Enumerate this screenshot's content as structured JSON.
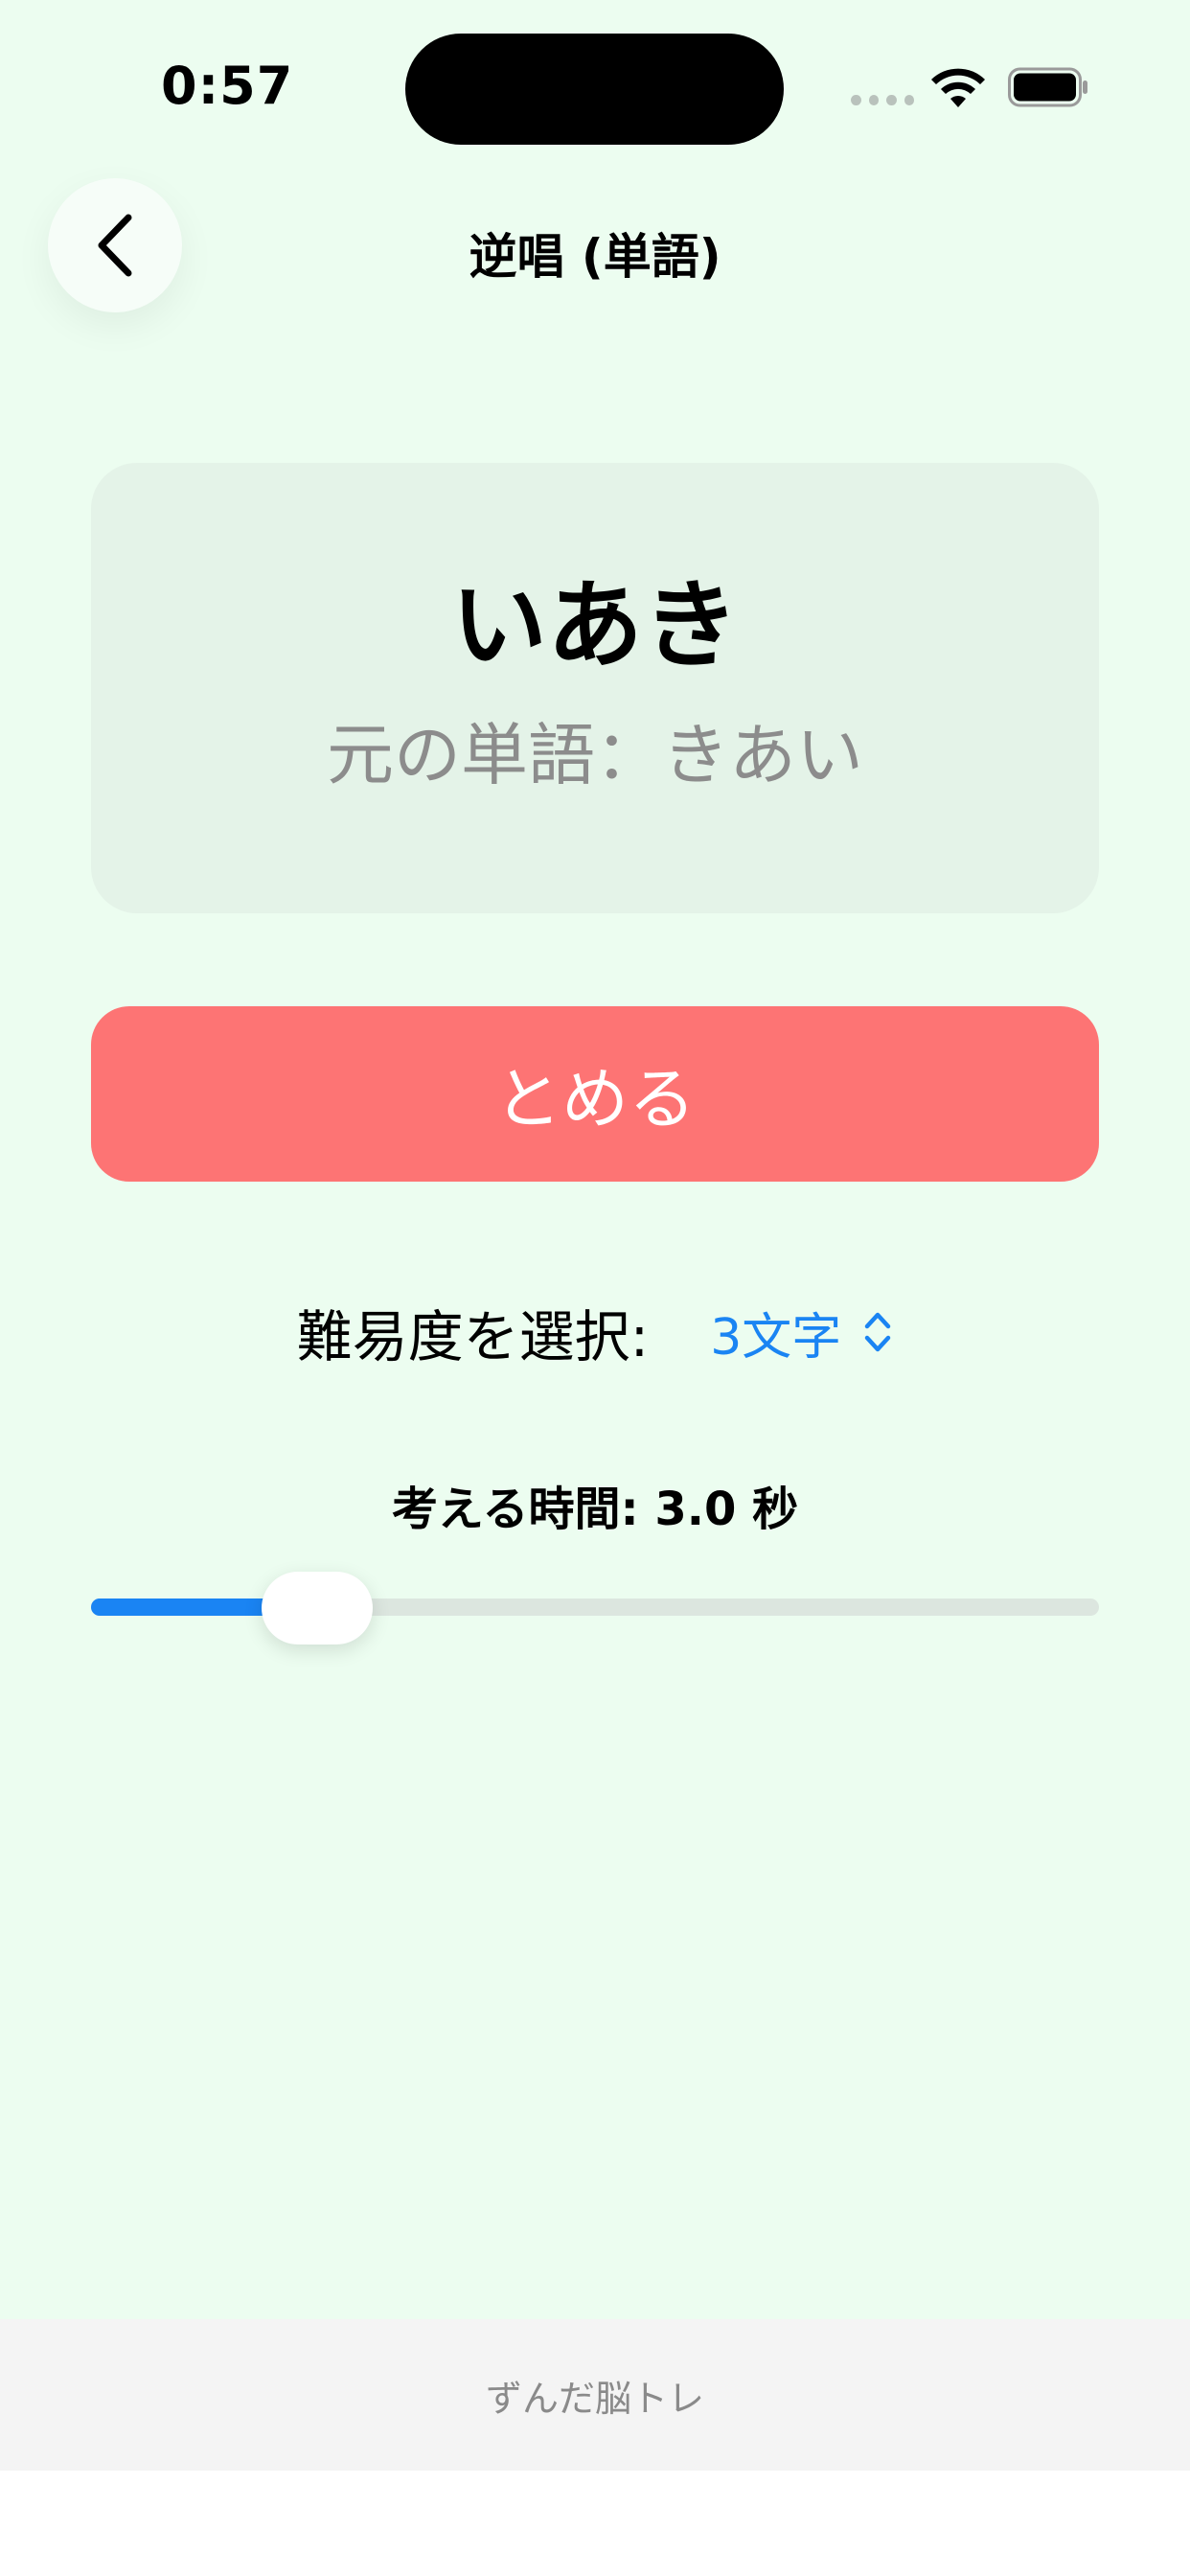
{
  "status_bar": {
    "time": "0:57",
    "wifi_icon": "wifi-icon",
    "battery_icon": "battery-icon",
    "signal_icon": "cellular-signal-icon"
  },
  "header": {
    "back_icon": "chevron-left-icon",
    "title": "逆唱 (単語)"
  },
  "card": {
    "reversed_word": "いあき",
    "original_word": "元の単語：きあい"
  },
  "stop_button": {
    "label": "とめる"
  },
  "difficulty": {
    "label": "難易度を選択:",
    "selected": "3文字",
    "icon": "chevron-up-down-icon"
  },
  "think_time": {
    "label": "考える時間: 3.0 秒",
    "slider_fraction": 0.19
  },
  "footer": {
    "text": "ずんだ脳トレ"
  },
  "colors": {
    "background": "#ecfdf0",
    "card": "#e4f3e8",
    "stop_button": "#fd7474",
    "accent": "#1a84f3",
    "footer": "#f4f4f4"
  }
}
